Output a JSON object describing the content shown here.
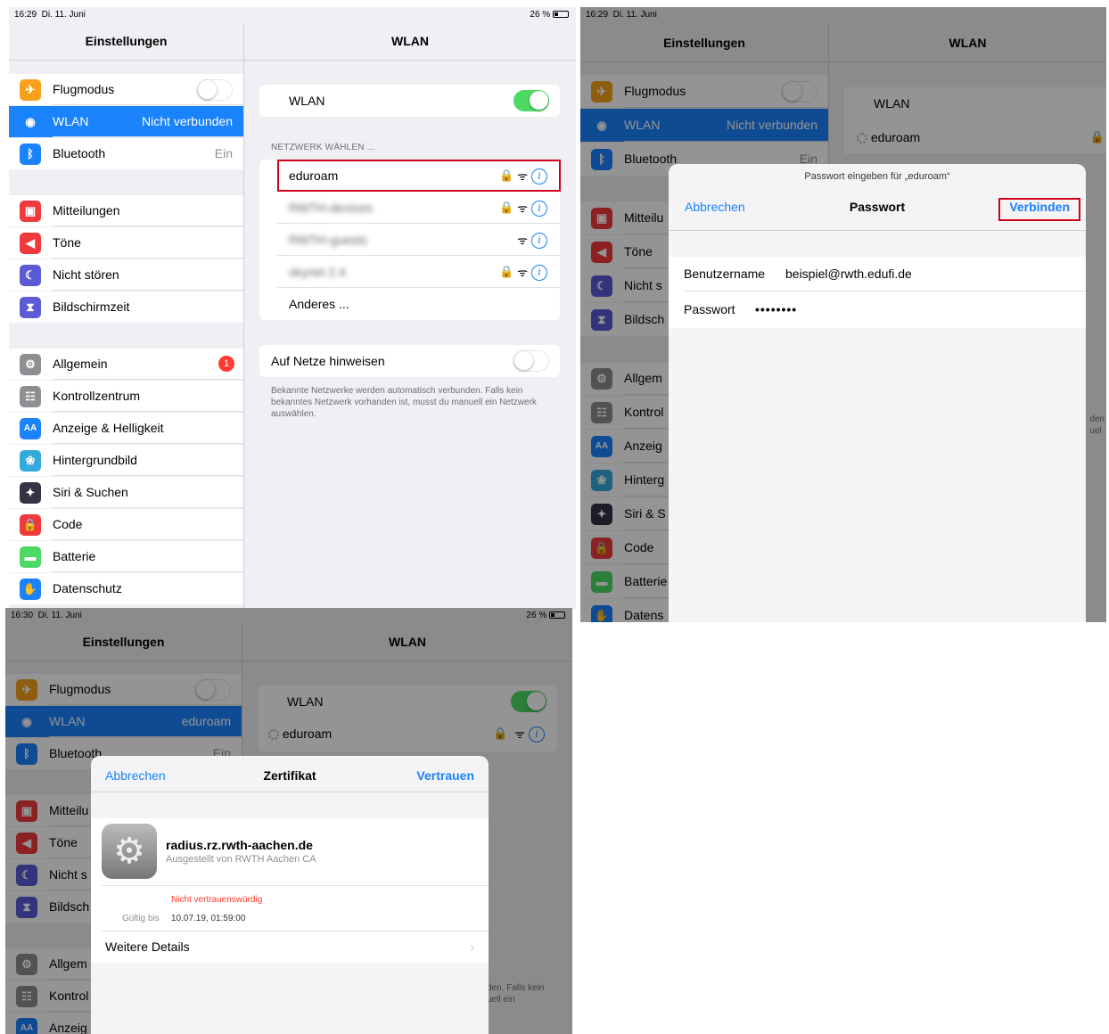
{
  "shot1": {
    "status": {
      "time": "16:29",
      "date": "Di. 11. Juni",
      "battery": "26 %"
    },
    "sidebar_title": "Einstellungen",
    "detail_title": "WLAN",
    "rows": [
      {
        "label": "Flugmodus",
        "icon": "airplane-icon",
        "color": "#f7a01c",
        "glyph": "✈",
        "toggle": "off"
      },
      {
        "label": "WLAN",
        "value": "Nicht verbunden",
        "icon": "wifi-icon",
        "color": "#1a82fb",
        "glyph": "◉",
        "selected": true
      },
      {
        "label": "Bluetooth",
        "value": "Ein",
        "icon": "bluetooth-icon",
        "color": "#1a82fb",
        "glyph": "ᛒ"
      },
      {
        "label": "Mitteilungen",
        "icon": "notifications-icon",
        "color": "#f0393c",
        "glyph": "▣"
      },
      {
        "label": "Töne",
        "icon": "sounds-icon",
        "color": "#f0393c",
        "glyph": "◀"
      },
      {
        "label": "Nicht stören",
        "icon": "moon-icon",
        "color": "#5b5bd6",
        "glyph": "☾"
      },
      {
        "label": "Bildschirmzeit",
        "icon": "hourglass-icon",
        "color": "#5b5bd6",
        "glyph": "⧗"
      },
      {
        "label": "Allgemein",
        "icon": "gear-icon",
        "color": "#8e8e93",
        "glyph": "⚙",
        "badge": "1"
      },
      {
        "label": "Kontrollzentrum",
        "icon": "control-center-icon",
        "color": "#8e8e93",
        "glyph": "☷"
      },
      {
        "label": "Anzeige & Helligkeit",
        "icon": "display-icon",
        "color": "#1a82fb",
        "glyph": "AA"
      },
      {
        "label": "Hintergrundbild",
        "icon": "wallpaper-icon",
        "color": "#34aadc",
        "glyph": "❀"
      },
      {
        "label": "Siri & Suchen",
        "icon": "siri-icon",
        "color": "#333344",
        "glyph": "✦"
      },
      {
        "label": "Code",
        "icon": "lock-icon",
        "color": "#f0393c",
        "glyph": "🔒"
      },
      {
        "label": "Batterie",
        "icon": "battery-icon",
        "color": "#4cd964",
        "glyph": "▬"
      },
      {
        "label": "Datenschutz",
        "icon": "hand-icon",
        "color": "#1a82fb",
        "glyph": "✋"
      }
    ],
    "wlan_label": "WLAN",
    "section_header": "NETZWERK WÄHLEN ...",
    "networks": [
      {
        "name": "eduroam",
        "lock": true
      },
      {
        "name": "RWTH-devices",
        "lock": true,
        "blurred": true
      },
      {
        "name": "RWTH-guests",
        "lock": false,
        "blurred": true
      },
      {
        "name": "skynet 2.4",
        "lock": true,
        "blurred": true
      }
    ],
    "other": "Anderes ...",
    "hint_label": "Auf Netze hinweisen",
    "hint_footer": "Bekannte Netzwerke werden automatisch verbunden. Falls kein bekanntes Netzwerk vorhanden ist, musst du manuell ein Netzwerk auswählen."
  },
  "shot2": {
    "status": {
      "time": "16:29",
      "date": "Di. 11. Juni"
    },
    "sidebar_title": "Einstellungen",
    "detail_title": "WLAN",
    "rows": [
      "Flugmodus",
      "WLAN",
      "Bluetooth",
      "Mitteilu",
      "Töne",
      "Nicht s",
      "Bildsch",
      "Allgem",
      "Kontrol",
      "Anzeig",
      "Hinterg",
      "Siri & S",
      "Code",
      "Batterie",
      "Datens"
    ],
    "wlan_value": "Nicht verbunden",
    "bluetooth_value": "Ein",
    "detail_wlan": "WLAN",
    "detail_network": "eduroam",
    "footer_fragment": "den\nuel",
    "modal": {
      "prompt": "Passwort eingeben für „eduroam“",
      "cancel": "Abbrechen",
      "title": "Passwort",
      "connect": "Verbinden",
      "username_label": "Benutzername",
      "username_value": "beispiel@rwth.edufi.de",
      "password_label": "Passwort",
      "password_value": "••••••••"
    }
  },
  "shot3": {
    "status": {
      "time": "16:30",
      "date": "Di. 11. Juni",
      "battery": "26 %"
    },
    "sidebar_title": "Einstellungen",
    "detail_title": "WLAN",
    "rows": [
      "Flugmodus",
      "WLAN",
      "Bluetooth",
      "Mitteilu",
      "Töne",
      "Nicht s",
      "Bildsch",
      "Allgem",
      "Kontrol",
      "Anzeig"
    ],
    "wlan_value": "eduroam",
    "bluetooth_value": "Ein",
    "detail_wlan": "WLAN",
    "detail_network": "eduroam",
    "footer_fragment": "den. Falls kein\nuell ein",
    "modal": {
      "cancel": "Abbrechen",
      "title": "Zertifikat",
      "trust": "Vertrauen",
      "host": "radius.rz.rwth-aachen.de",
      "issuer": "Ausgestellt von RWTH Aachen CA",
      "warning": "Nicht vertrauenswürdig",
      "valid_label": "Gültig bis",
      "valid_value": "10.07.19, 01:59:00",
      "more": "Weitere Details"
    }
  }
}
